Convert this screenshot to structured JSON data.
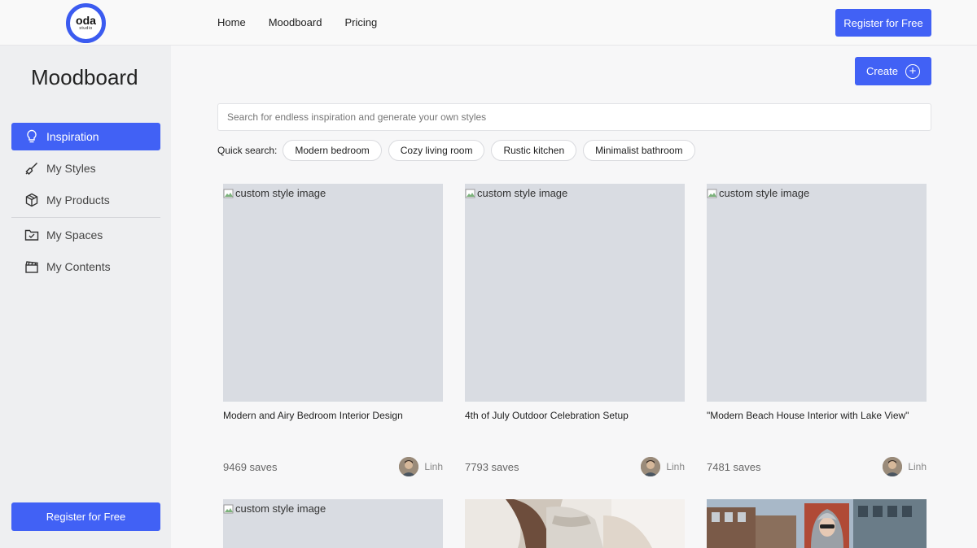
{
  "logo": {
    "line1": "oda",
    "line2": "studio"
  },
  "nav": {
    "items": [
      "Home",
      "Moodboard",
      "Pricing"
    ],
    "register_label": "Register for Free"
  },
  "sidebar": {
    "title": "Moodboard",
    "items": [
      {
        "label": "Inspiration",
        "icon": "lightbulb-icon",
        "active": true
      },
      {
        "label": "My Styles",
        "icon": "paintbrush-icon"
      },
      {
        "label": "My Products",
        "icon": "box-icon"
      },
      {
        "label": "My Spaces",
        "icon": "folder-check-icon"
      },
      {
        "label": "My Contents",
        "icon": "clapperboard-icon"
      }
    ],
    "register_label": "Register for Free"
  },
  "main": {
    "create_label": "Create",
    "search_placeholder": "Search for endless inspiration and generate your own styles",
    "quick_search_label": "Quick search:",
    "quick_search": [
      "Modern bedroom",
      "Cozy living room",
      "Rustic kitchen",
      "Minimalist bathroom"
    ],
    "image_alt": "custom style image",
    "cards": [
      {
        "title": "Modern and Airy Bedroom Interior Design",
        "saves": "9469 saves",
        "user": "Linh"
      },
      {
        "title": "4th of July Outdoor Celebration Setup",
        "saves": "7793 saves",
        "user": "Linh"
      },
      {
        "title": "\"Modern Beach House Interior with Lake View\"",
        "saves": "7481 saves",
        "user": "Linh"
      }
    ]
  },
  "colors": {
    "accent": "#4161f5",
    "placeholder_bg": "#d9dce2"
  }
}
